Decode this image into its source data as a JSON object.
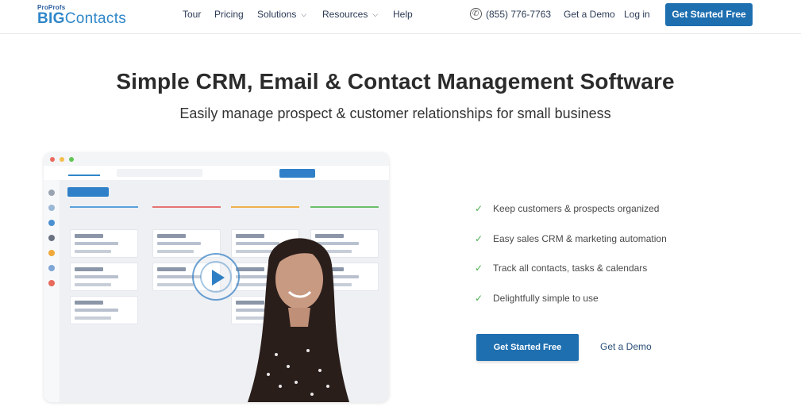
{
  "brand": {
    "top": "ProProfs",
    "big": "BIG",
    "rest": "Contacts"
  },
  "nav": {
    "items": [
      {
        "label": "Tour"
      },
      {
        "label": "Pricing"
      },
      {
        "label": "Solutions",
        "has_dropdown": true
      },
      {
        "label": "Resources",
        "has_dropdown": true
      },
      {
        "label": "Help"
      }
    ],
    "phone": "(855) 776-7763",
    "demo": "Get a Demo",
    "login": "Log in",
    "cta": "Get Started Free"
  },
  "hero": {
    "title": "Simple CRM, Email & Contact Management Software",
    "subtitle": "Easily manage prospect & customer relationships for small business"
  },
  "features": [
    "Keep customers & prospects organized",
    "Easy sales CRM & marketing automation",
    "Track all contacts, tasks & calendars",
    "Delightfully simple to use"
  ],
  "cta": {
    "primary": "Get Started Free",
    "secondary": "Get a Demo"
  },
  "colors": {
    "primary": "#1e6fb0",
    "brand": "#2f86c9",
    "check": "#4caf50"
  },
  "icons": {
    "phone": "phone-icon",
    "check": "check-icon",
    "play": "play-icon",
    "chevron": "chevron-down-icon"
  }
}
